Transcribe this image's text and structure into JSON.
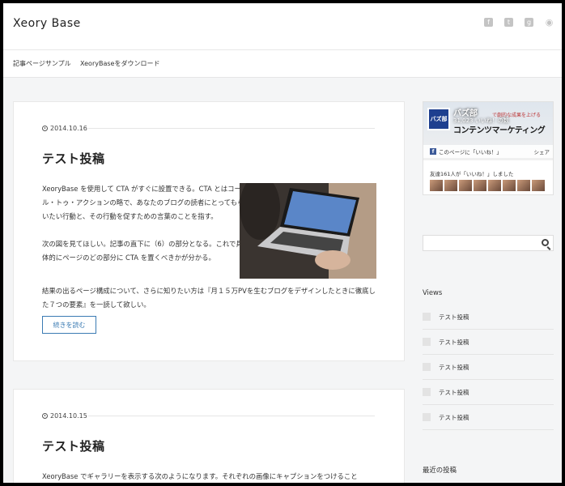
{
  "header": {
    "site_title": "Xeory Base",
    "social_icons": [
      "facebook-icon",
      "twitter-icon",
      "google-plus-icon",
      "rss-icon"
    ]
  },
  "nav": {
    "items": [
      {
        "label": "記事ページサンプル"
      },
      {
        "label": "XeoryBaseをダウンロード"
      }
    ]
  },
  "posts": [
    {
      "date": "2014.10.16",
      "title": "テスト投稿",
      "paragraphs": [
        "XeoryBase を使用して CTA がすぐに設置できる。CTA とはコール・トゥ・アクションの略で、あなたのブログの読者にとってもらいたい行動と、その行動を促すための言葉のことを指す。",
        "次の図を見てほしい。記事の直下に（6）の部分となる。これで具体的にページのどの部分に CTA を置くべきかが分かる。"
      ],
      "paragraph_full": "結果の出るページ構成について、さらに知りたい方は『月１５万PVを生むブログをデザインしたときに徹底した７つの要素』を一読して欲しい。",
      "read_more": "続きを読む"
    },
    {
      "date": "2014.10.15",
      "title": "テスト投稿",
      "paragraph_full": "XeoryBase でギャラリーを表示する次のようになります。それぞれの画像にキャプションをつけること"
    }
  ],
  "sidebar": {
    "fb": {
      "logo_text": "バズ部",
      "name": "バズ部",
      "likes": "31,023 いいね！の数",
      "tagline": "コンテンツマーケティング",
      "sub": "で劇的な成果を上げる",
      "like_bar": "このページに「いいね！」",
      "share": "シェア",
      "friends": "友達161人が「いいね！」しました"
    },
    "views_title": "Views",
    "views_items": [
      "テスト投稿",
      "テスト投稿",
      "テスト投稿",
      "テスト投稿",
      "テスト投稿"
    ],
    "recent_title": "最近の投稿"
  }
}
